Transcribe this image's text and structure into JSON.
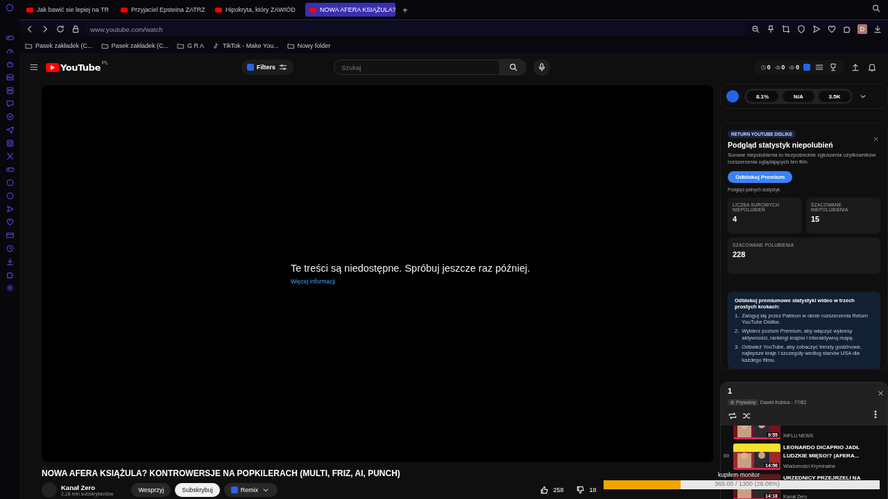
{
  "tabs": [
    {
      "title": "Jak bawić sie lepiej na TR",
      "selected": false
    },
    {
      "title": "Przyjaciel Epsteina ZATRZ",
      "selected": false
    },
    {
      "title": "Hipokryta, który ZAWIÓD",
      "selected": false
    },
    {
      "title": "NOWA AFERA KSIĄŻULA?",
      "selected": true
    }
  ],
  "new_tab": "+",
  "address": "www.youtube.com/watch",
  "profile": "D",
  "bookmarks": [
    {
      "label": "Pasek zakładek (C...",
      "kind": "folder"
    },
    {
      "label": "Pasek zakładek (C...",
      "kind": "folder"
    },
    {
      "label": "G R A",
      "kind": "folder"
    },
    {
      "label": "TikTok - Make You...",
      "kind": "tiktok"
    },
    {
      "label": "Nowy folder",
      "kind": "folder"
    }
  ],
  "youtube": {
    "logo": "YouTube",
    "region": "PL",
    "filters": "Filters",
    "search_placeholder": "Szukaj",
    "counters": [
      "0",
      "0",
      "0"
    ]
  },
  "player": {
    "message": "Te treści są niedostępne. Spróbuj jeszcze raz później.",
    "link": "Więcej informacji"
  },
  "video": {
    "title": "NOWA AFERA KSIĄŻULA? KONTROWERSJE NA POPKILERACH (MULTI, FRIZ, AI, PUNCH)",
    "channel": "Kanał Zero",
    "subscribers": "2,18 mln subskrybentów",
    "support": "Wesprzyj",
    "subscribe": "Subskrybuj",
    "remix": "Remix",
    "likes": "258",
    "dislikes": "18"
  },
  "iq_bar": [
    "8.1%",
    "N/A",
    "3.5K"
  ],
  "ryd": {
    "badge": "RETURN YOUTUBE DISLIKE",
    "title": "Podgląd statystyk niepolubień",
    "description": "Surowe niepolubienia to bezpośrednie zgłoszenia użytkowników rozszerzenia oglądających ten film.",
    "button": "Odblokuj Premium",
    "note": "Podgląd pełnych statystyk",
    "stats": [
      {
        "label": "LICZBA SUROWYCH NIEPOLUBIEŃ",
        "value": "4"
      },
      {
        "label": "SZACOWANE NIEPOLUBIENIA",
        "value": "15"
      },
      {
        "label": "SZACOWANE POLUBIENIA",
        "value": "228"
      }
    ],
    "promo_title": "Odblokuj premiumowe statystyki wideo w trzech prostych krokach:",
    "steps": [
      {
        "number": "1.",
        "text": "Zaloguj się przez Patreon w oknie rozszerzenia Return YouTube Dislike."
      },
      {
        "number": "2.",
        "text": "Wybierz poziom Premium, aby włączyć wykresy aktywności, rankingi krajów i interaktywną mapę."
      },
      {
        "number": "3.",
        "text": "Odśwież YouTube, aby zobaczyć trendy godzinowe, najlepsze kraje i szczegóły według stanów USA dla każdego filmu."
      }
    ]
  },
  "playlist": {
    "title": "1",
    "privacy": "Prywatny",
    "owner": "Dawid Kubica - 77/82",
    "items": [
      {
        "duration": "9:55",
        "channel": "INFLU NEWS"
      },
      {
        "index": "69",
        "duration": "14:56",
        "title": "LEONARDO DICAPRIO JADŁ LUDZKIE MIĘSO!? (AFERA...",
        "channel": "Wiadomości Kryminalne"
      },
      {
        "duration": "14:18",
        "title": "URZĘDNICY PRZEJRZELI NA",
        "channel": "Kanał Zero"
      }
    ]
  },
  "overlay": {
    "label": "kupiłem monitor",
    "reading": "365.00 / 1300 (28.08%)",
    "level": 0.28
  }
}
